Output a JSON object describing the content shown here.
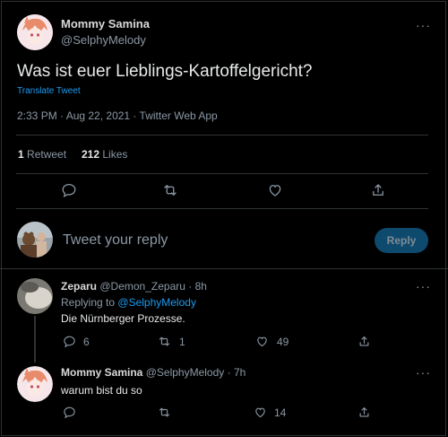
{
  "main_tweet": {
    "author_name": "Mommy Samina",
    "author_handle": "@SelphyMelody",
    "more": "···",
    "text": "Was ist euer Lieblings-Kartoffelgericht?",
    "translate": "Translate Tweet",
    "meta": "2:33 PM · Aug 22, 2021 · Twitter Web App",
    "retweets_count": "1",
    "retweets_label": "Retweet",
    "likes_count": "212",
    "likes_label": "Likes"
  },
  "reply_box": {
    "placeholder": "Tweet your reply",
    "button": "Reply"
  },
  "replies": [
    {
      "author_name": "Zeparu",
      "author_handle": "@Demon_Zeparu",
      "time": "· 8h",
      "more": "···",
      "replying_prefix": "Replying to",
      "replying_to": "@SelphyMelody",
      "text": "Die Nürnberger Prozesse.",
      "reply_count": "6",
      "retweet_count": "1",
      "like_count": "49"
    },
    {
      "author_name": "Mommy Samina",
      "author_handle": "@SelphyMelody",
      "time": "· 7h",
      "more": "···",
      "text": "warum bist du so",
      "reply_count": "",
      "retweet_count": "",
      "like_count": "14"
    }
  ],
  "colors": {
    "background": "#000000",
    "accent": "#1d9bf0",
    "muted": "#8b98a5",
    "border": "#2f3336"
  }
}
